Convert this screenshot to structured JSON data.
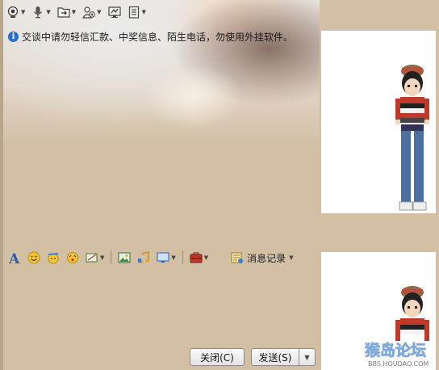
{
  "toolbar_top": {
    "items": [
      {
        "icon": "webcam-icon"
      },
      {
        "icon": "microphone-icon"
      },
      {
        "icon": "file-transfer-icon"
      },
      {
        "icon": "add-contact-icon"
      },
      {
        "icon": "remote-assist-icon"
      },
      {
        "icon": "notepad-icon"
      }
    ]
  },
  "notice": {
    "text": "交谈中请勿轻信汇款、中奖信息、陌生电话，勿使用外挂软件。"
  },
  "toolbar_format": {
    "items": [
      {
        "icon": "font-icon"
      },
      {
        "icon": "emoticon-icon"
      },
      {
        "icon": "magic-emoticon-icon"
      },
      {
        "icon": "shake-icon"
      },
      {
        "icon": "screenshot-icon"
      },
      {
        "icon": "image-icon"
      },
      {
        "icon": "music-icon"
      },
      {
        "icon": "screen-share-icon"
      },
      {
        "icon": "toolbox-icon"
      }
    ],
    "history_label": "消息记录"
  },
  "buttons": {
    "close_label": "关闭(C)",
    "send_label": "发送(S)"
  },
  "watermark": {
    "title": "猴岛论坛",
    "url": "BBS.HOUDAO.COM"
  },
  "colors": {
    "background": "#d2bfa4",
    "info_blue": "#2a6fc9",
    "panel": "#ffffff"
  }
}
